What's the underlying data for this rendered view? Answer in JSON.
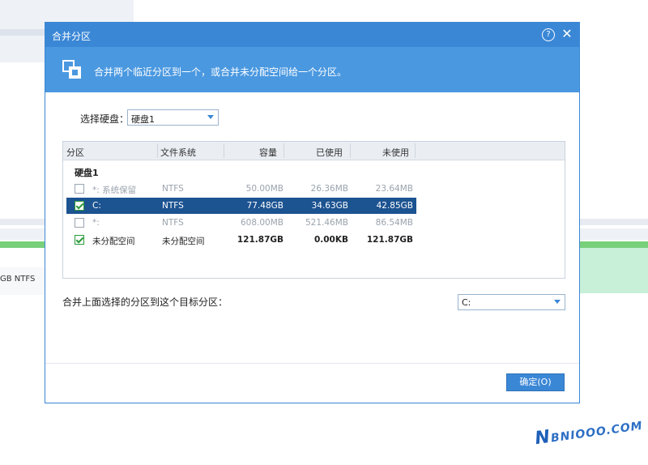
{
  "background": {
    "partition_label": "GB NTFS"
  },
  "dialog": {
    "title": "合并分区",
    "help_icon": "question-circle-icon",
    "close_icon": "close-icon",
    "banner_icon": "merge-partition-icon",
    "banner_text": "合并两个临近分区到一个，或合并未分配空间给一个分区。",
    "disk_label": "选择硬盘：",
    "disk_select_value": "硬盘1",
    "table": {
      "headers": [
        "分区",
        "文件系统",
        "容量",
        "已使用",
        "未使用"
      ],
      "group": "硬盘1",
      "rows": [
        {
          "name": "*: 系统保留",
          "fs": "NTFS",
          "capacity": "50.00MB",
          "used": "26.36MB",
          "free": "23.64MB",
          "checked": false,
          "selected": false,
          "disabled": true
        },
        {
          "name": "C:",
          "fs": "NTFS",
          "capacity": "77.48GB",
          "used": "34.63GB",
          "free": "42.85GB",
          "checked": true,
          "selected": true,
          "disabled": false
        },
        {
          "name": "*:",
          "fs": "NTFS",
          "capacity": "608.00MB",
          "used": "521.46MB",
          "free": "86.54MB",
          "checked": false,
          "selected": false,
          "disabled": true
        },
        {
          "name": "未分配空间",
          "fs": "未分配空间",
          "capacity": "121.87GB",
          "used": "0.00KB",
          "free": "121.87GB",
          "checked": true,
          "selected": false,
          "disabled": false
        }
      ]
    },
    "target_label": "合并上面选择的分区到这个目标分区：",
    "target_select_value": "C:",
    "ok_button": "确定(O)"
  },
  "watermark": {
    "letter": "N",
    "text": "BNIOOO.COM"
  },
  "colors": {
    "accent": "#3a87d6",
    "banner": "#4a98e0",
    "selected_row": "#1c5391",
    "check": "#2b9a3b"
  }
}
